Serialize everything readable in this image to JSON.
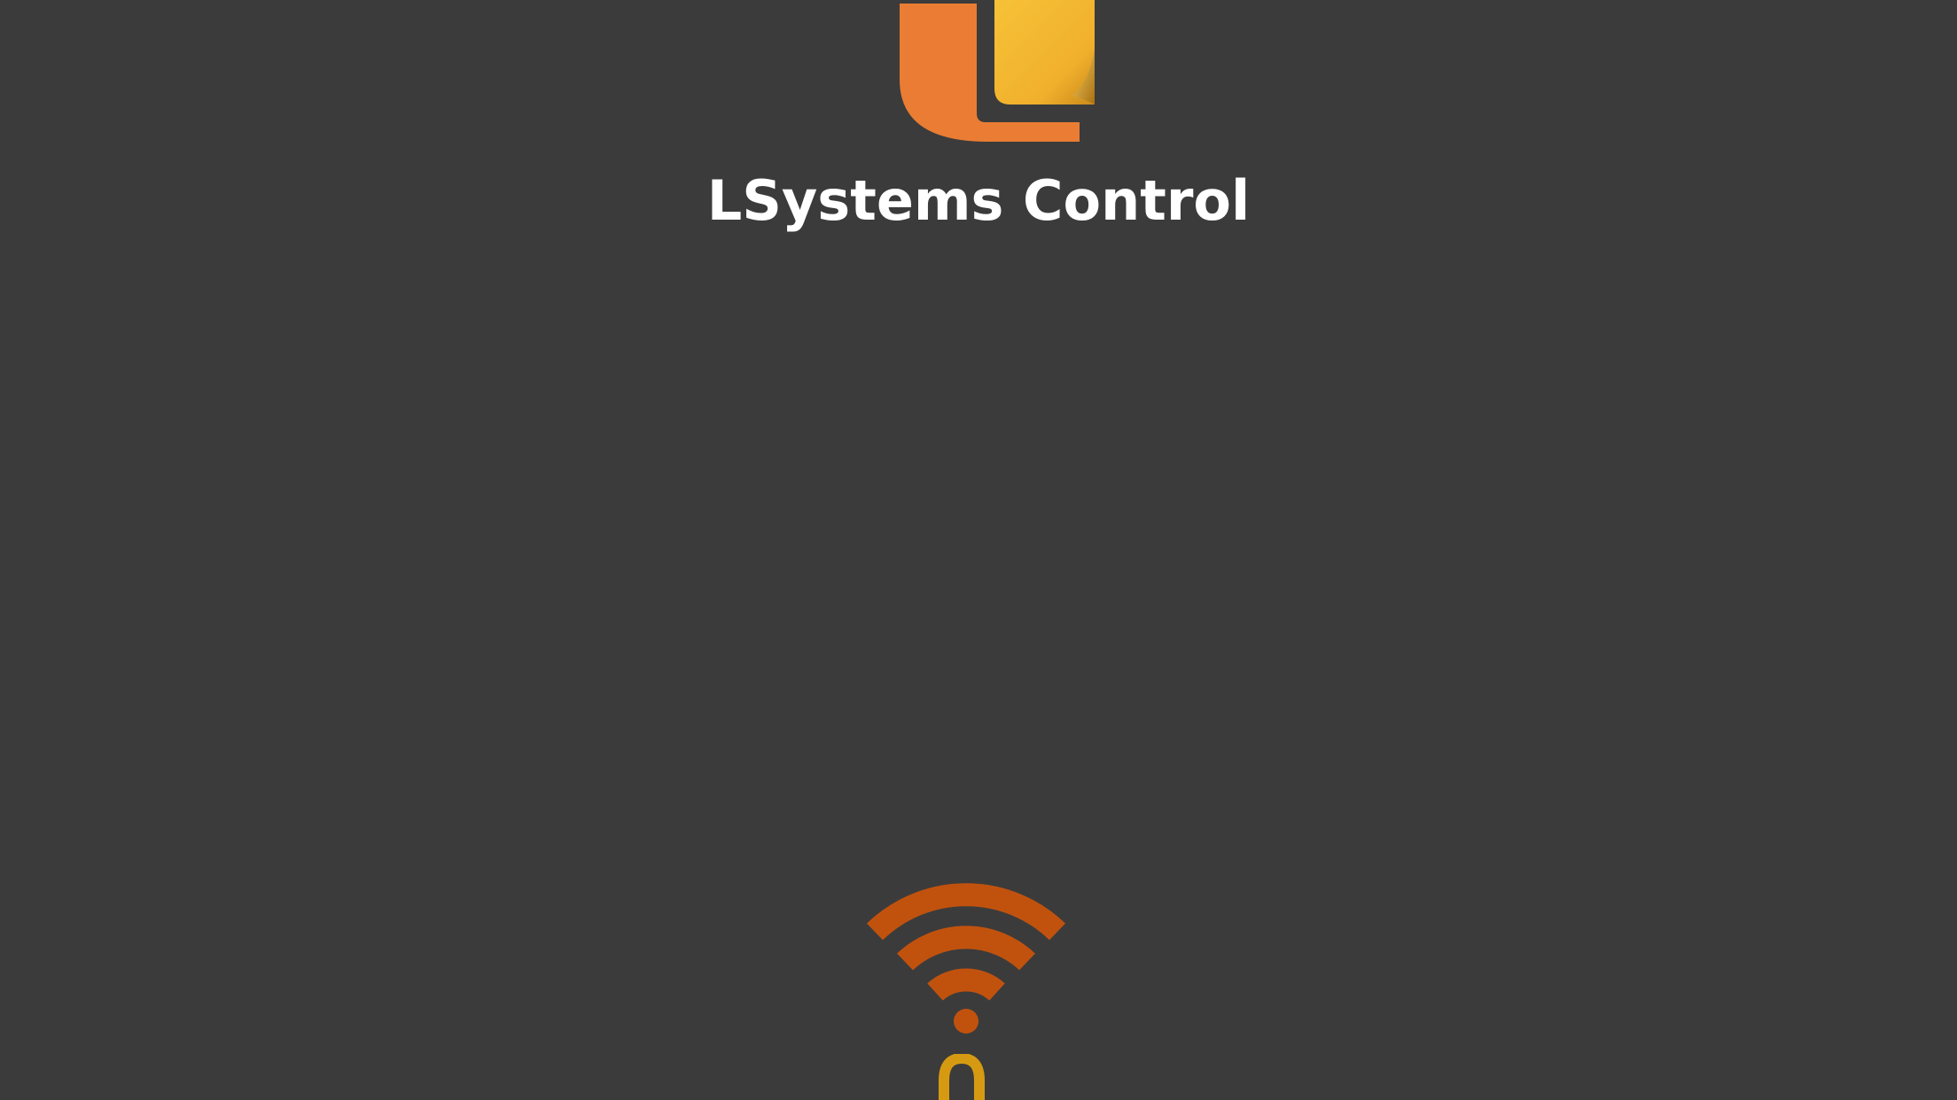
{
  "app": {
    "title": "LSystems Control"
  },
  "colors": {
    "background": "#3b3b3b",
    "logo_orange": "#ea7d33",
    "logo_yellow": "#f4b731",
    "wifi_orange": "#c1520e",
    "touch_gold": "#d69a12",
    "title_text": "#ffffff"
  },
  "icons": {
    "logo": "app-logo",
    "connection": "wifi-icon",
    "touch": "touch-finger-icon"
  }
}
